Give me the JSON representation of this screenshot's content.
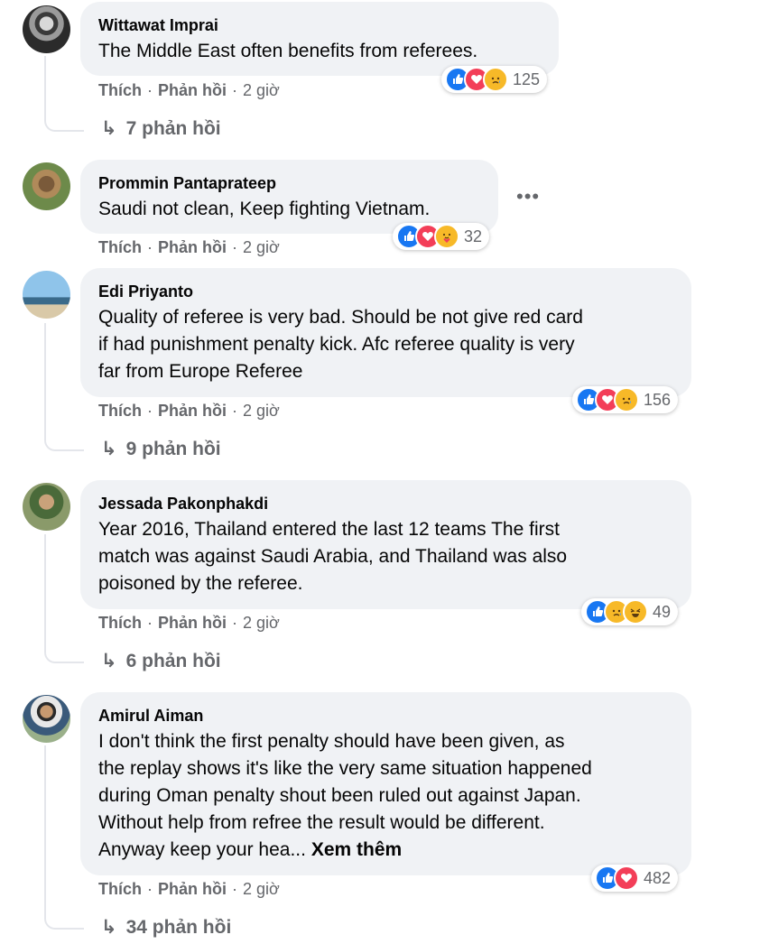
{
  "comments": [
    {
      "author": "Wittawat Imprai",
      "lines": [
        "The Middle East often benefits from referees."
      ],
      "like": "Thích",
      "reply": "Phản hồi",
      "time": "2 giờ",
      "reactions": [
        "like",
        "love",
        "sad"
      ],
      "count": "125",
      "replies": "7 phản hồi"
    },
    {
      "author": "Prommin Pantaprateep",
      "lines": [
        "Saudi not clean, Keep fighting Vietnam."
      ],
      "like": "Thích",
      "reply": "Phản hồi",
      "time": "2 giờ",
      "reactions": [
        "like",
        "love",
        "care"
      ],
      "count": "32",
      "more_menu": "•••"
    },
    {
      "author": "Edi Priyanto",
      "lines": [
        "Quality of referee is very bad. Should be not give red card",
        "if had punishment penalty kick. Afc referee quality is very",
        "far from Europe Referee"
      ],
      "like": "Thích",
      "reply": "Phản hồi",
      "time": "2 giờ",
      "reactions": [
        "like",
        "love",
        "sad"
      ],
      "count": "156",
      "replies": "9 phản hồi"
    },
    {
      "author": "Jessada Pakonphakdi",
      "lines": [
        "Year 2016, Thailand entered the last 12 teams The first",
        "match was against Saudi Arabia, and Thailand was also",
        "poisoned by the referee."
      ],
      "like": "Thích",
      "reply": "Phản hồi",
      "time": "2 giờ",
      "reactions": [
        "like",
        "sad",
        "haha"
      ],
      "count": "49",
      "replies": "6 phản hồi"
    },
    {
      "author": "Amirul Aiman",
      "lines": [
        "I don't think the first penalty should have been given, as",
        "the replay shows it's like the very same situation happened",
        "during Oman penalty shout been ruled out against Japan.",
        "Without help from refree the result would be different.",
        "Anyway keep your hea..."
      ],
      "see_more": "Xem thêm",
      "like": "Thích",
      "reply": "Phản hồi",
      "time": "2 giờ",
      "reactions": [
        "like",
        "love"
      ],
      "count": "482",
      "replies": "34 phản hồi"
    }
  ],
  "colors": {
    "bubble": "#f0f2f5",
    "secondary_text": "#65676b",
    "like_blue": "#1877f2",
    "love_red": "#f33e58",
    "emoji_yellow": "#f7b928"
  }
}
